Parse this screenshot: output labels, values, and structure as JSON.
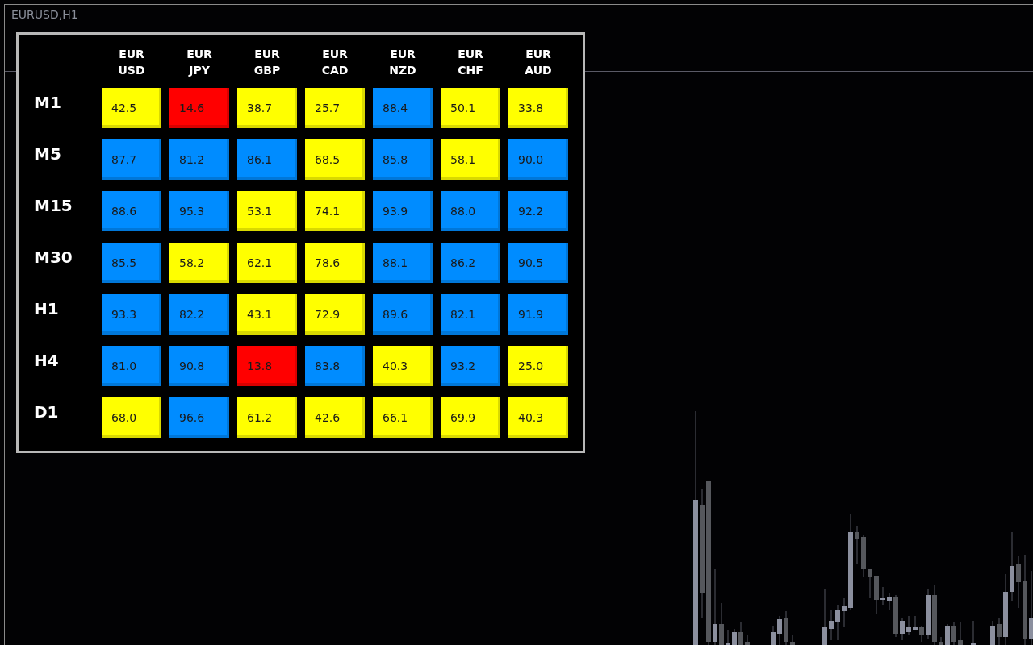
{
  "chart": {
    "title": "EURUSD,H1"
  },
  "columns": [
    {
      "base": "EUR",
      "quote": "USD"
    },
    {
      "base": "EUR",
      "quote": "JPY"
    },
    {
      "base": "EUR",
      "quote": "GBP"
    },
    {
      "base": "EUR",
      "quote": "CAD"
    },
    {
      "base": "EUR",
      "quote": "NZD"
    },
    {
      "base": "EUR",
      "quote": "CHF"
    },
    {
      "base": "EUR",
      "quote": "AUD"
    }
  ],
  "rows": [
    {
      "timeframe": "M1",
      "cells": [
        {
          "value": "42.5",
          "color": "#ffff00"
        },
        {
          "value": "14.6",
          "color": "#ff0000"
        },
        {
          "value": "38.7",
          "color": "#ffff00"
        },
        {
          "value": "25.7",
          "color": "#ffff00"
        },
        {
          "value": "88.4",
          "color": "#008cff"
        },
        {
          "value": "50.1",
          "color": "#ffff00"
        },
        {
          "value": "33.8",
          "color": "#ffff00"
        }
      ]
    },
    {
      "timeframe": "M5",
      "cells": [
        {
          "value": "87.7",
          "color": "#008cff"
        },
        {
          "value": "81.2",
          "color": "#008cff"
        },
        {
          "value": "86.1",
          "color": "#008cff"
        },
        {
          "value": "68.5",
          "color": "#ffff00"
        },
        {
          "value": "85.8",
          "color": "#008cff"
        },
        {
          "value": "58.1",
          "color": "#ffff00"
        },
        {
          "value": "90.0",
          "color": "#008cff"
        }
      ]
    },
    {
      "timeframe": "M15",
      "cells": [
        {
          "value": "88.6",
          "color": "#008cff"
        },
        {
          "value": "95.3",
          "color": "#008cff"
        },
        {
          "value": "53.1",
          "color": "#ffff00"
        },
        {
          "value": "74.1",
          "color": "#ffff00"
        },
        {
          "value": "93.9",
          "color": "#008cff"
        },
        {
          "value": "88.0",
          "color": "#008cff"
        },
        {
          "value": "92.2",
          "color": "#008cff"
        }
      ]
    },
    {
      "timeframe": "M30",
      "cells": [
        {
          "value": "85.5",
          "color": "#008cff"
        },
        {
          "value": "58.2",
          "color": "#ffff00"
        },
        {
          "value": "62.1",
          "color": "#ffff00"
        },
        {
          "value": "78.6",
          "color": "#ffff00"
        },
        {
          "value": "88.1",
          "color": "#008cff"
        },
        {
          "value": "86.2",
          "color": "#008cff"
        },
        {
          "value": "90.5",
          "color": "#008cff"
        }
      ]
    },
    {
      "timeframe": "H1",
      "cells": [
        {
          "value": "93.3",
          "color": "#008cff"
        },
        {
          "value": "82.2",
          "color": "#008cff"
        },
        {
          "value": "43.1",
          "color": "#ffff00"
        },
        {
          "value": "72.9",
          "color": "#ffff00"
        },
        {
          "value": "89.6",
          "color": "#008cff"
        },
        {
          "value": "82.1",
          "color": "#008cff"
        },
        {
          "value": "91.9",
          "color": "#008cff"
        }
      ]
    },
    {
      "timeframe": "H4",
      "cells": [
        {
          "value": "81.0",
          "color": "#008cff"
        },
        {
          "value": "90.8",
          "color": "#008cff"
        },
        {
          "value": "13.8",
          "color": "#ff0000"
        },
        {
          "value": "83.8",
          "color": "#008cff"
        },
        {
          "value": "40.3",
          "color": "#ffff00"
        },
        {
          "value": "93.2",
          "color": "#008cff"
        },
        {
          "value": "25.0",
          "color": "#ffff00"
        }
      ]
    },
    {
      "timeframe": "D1",
      "cells": [
        {
          "value": "68.0",
          "color": "#ffff00"
        },
        {
          "value": "96.6",
          "color": "#008cff"
        },
        {
          "value": "61.2",
          "color": "#ffff00"
        },
        {
          "value": "42.6",
          "color": "#ffff00"
        },
        {
          "value": "66.1",
          "color": "#ffff00"
        },
        {
          "value": "69.9",
          "color": "#ffff00"
        },
        {
          "value": "40.3",
          "color": "#ffff00"
        }
      ]
    }
  ]
}
